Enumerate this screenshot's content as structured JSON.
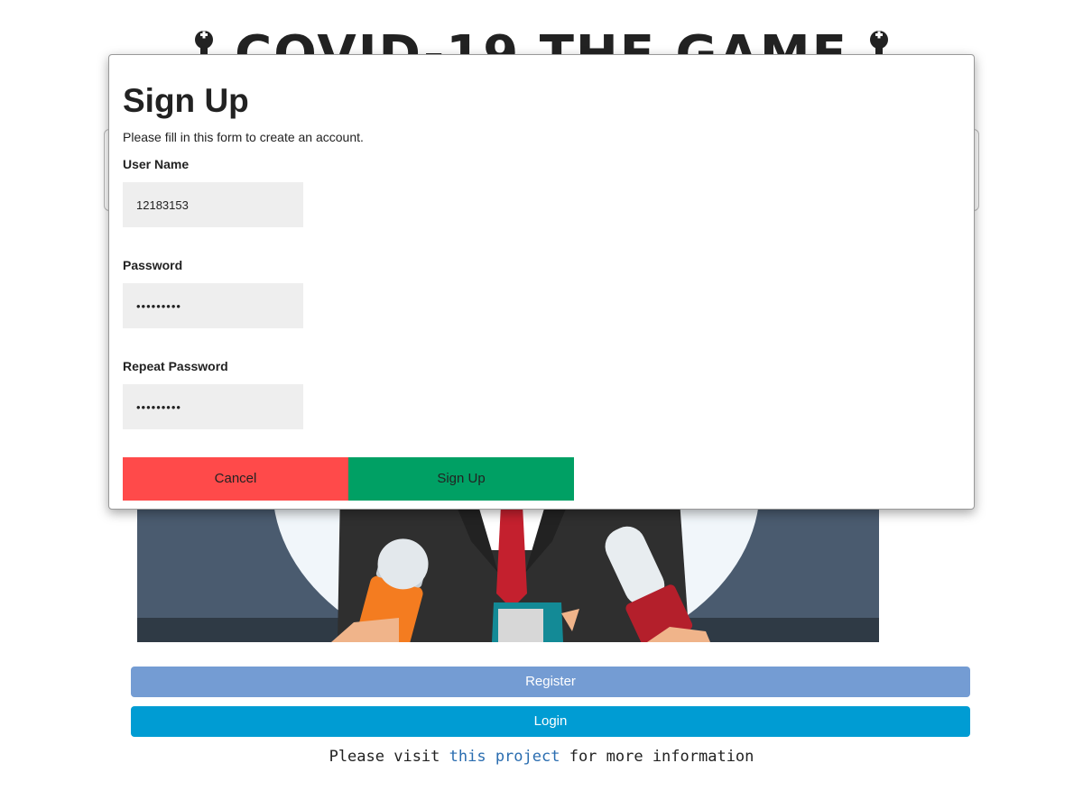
{
  "page": {
    "title": "COVID-19 THE GAME",
    "register_label": "Register",
    "login_label": "Login",
    "info_prefix": "Please visit ",
    "info_link": "this project",
    "info_suffix": " for more information"
  },
  "signup_modal": {
    "title": "Sign Up",
    "subtitle": "Please fill in this form to create an account.",
    "username_label": "User Name",
    "username_value": "12183153",
    "password_label": "Password",
    "password_value": "123456789",
    "repeat_label": "Repeat Password",
    "repeat_value": "123456789",
    "cancel_label": "Cancel",
    "signup_label": "Sign Up"
  },
  "colors": {
    "cancel": "#ff4a4a",
    "signup": "#00a064",
    "register": "#749cd3",
    "login": "#009cd3",
    "link": "#2a6db0"
  },
  "icons": [
    "joystick-icon"
  ]
}
